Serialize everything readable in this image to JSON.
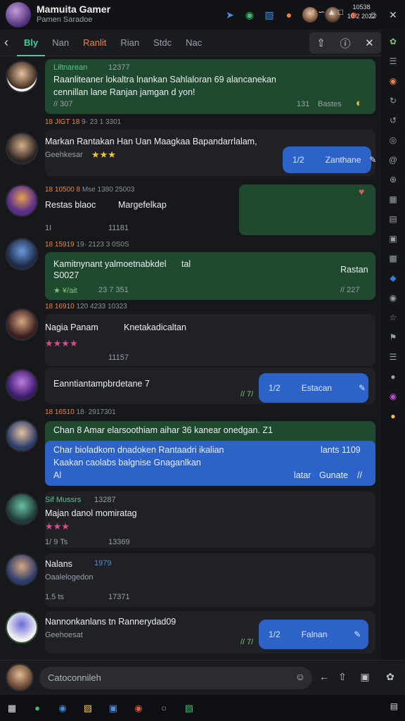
{
  "title": {
    "main": "Mamuita Gamer",
    "sub": "Pamen Saradoe"
  },
  "titlebar_icons": [
    "pin-icon",
    "puzzle-icon",
    "badge-icon",
    "record-icon",
    "user-avatar",
    "user-avatar-2",
    "figure-icon",
    "smiley-icon",
    "close-icon"
  ],
  "tabs": [
    {
      "label": "Bly",
      "active": true
    },
    {
      "label": "Nan"
    },
    {
      "label": "Ranlit",
      "accent": "orange"
    },
    {
      "label": "Rian"
    },
    {
      "label": "Stdc"
    },
    {
      "label": "Nac"
    }
  ],
  "feed": [
    {
      "name": "Liltnarean",
      "time": "12377",
      "line1": "Raanliteaner lokaltra lnankan Sahlaloran 69 alancanekan",
      "line2": "cennillan lane Ranjan jamgan d yon!",
      "footer_left": "// 307",
      "footer_right_a": "131",
      "footer_right_b": "Bastes"
    },
    {
      "meta": "18 JIGT 18",
      "meta_rest": "9· 23 1 3301",
      "text": "Markan Rantakan Han Uan Maagkaa Bapandarrlalam,",
      "sub": "Geehkesar",
      "stars": "★★★",
      "pill_a": "1/2",
      "pill_b": "Zanthane"
    },
    {
      "meta": "18 10500 8",
      "meta_rest": "Mse 1380 25003",
      "text": "Restas blaoc",
      "text_b": "Margefelkap",
      "footer_a": "1I",
      "footer_b": "11181"
    },
    {
      "meta": "18 15919",
      "meta_rest": "19· 2123 3 0S0S",
      "text": "Kamitnynant yalmoetnabkdel",
      "text_b": "tal",
      "line2": "S0027",
      "right": "Rastan",
      "footer_left": "★ ¥/ait",
      "footer_mid": "23 7 351",
      "footer_right": "// 227"
    },
    {
      "meta": "18 16910",
      "meta_rest": "120 4233 10323",
      "text": "Nagia Panam",
      "text_b": "Knetakadicaltan",
      "stars": "★★★★",
      "footer": "11157"
    },
    {
      "text": "Eanntiantampbrdetane",
      "text_b": "7",
      "footer_left": "// 7/",
      "pill_a": "1/2",
      "pill_b": "Estacan"
    },
    {
      "meta": "18 16510",
      "meta_rest": "18· 2917301",
      "line1": "Chan 8 Amar elarsoothiam aihar 36 kanear onedgan. Z1",
      "blue_line1": "Char bioladkom dnadoken Rantaadri ikalian",
      "blue_right": "lants 1109",
      "blue_line2": "Kaakan caolabs balgnise Gnaganlkan",
      "blue_line3": "Al",
      "blue_b1": "latar",
      "blue_b2": "Gunate",
      "blue_b3": "//"
    },
    {
      "name": "Sif Mussrs",
      "time": "13287",
      "text": "Majan danol momiratag",
      "stars": "★★★",
      "footer_a": "1/ 9 Ts",
      "footer_b": "13369"
    },
    {
      "text": "Nalans",
      "time": "1979",
      "sub": "Oaalelogedon",
      "footer_a": "1.5 ts",
      "footer_b": "17371"
    },
    {
      "text": "Nannonkanlans  tn Rannerydad09",
      "sub": "Geehoesat",
      "footer_left": "// 7/",
      "pill_a": "1/2",
      "pill_b": "Falnan"
    }
  ],
  "input": {
    "placeholder": "Catoconnileh"
  },
  "clock": {
    "time": "10538",
    "date": "10 2 2022"
  },
  "colors": {
    "accent": "#38d19a",
    "orange": "#f0843c",
    "green_card": "#1f4a30",
    "blue_pill": "#2d63c8"
  }
}
